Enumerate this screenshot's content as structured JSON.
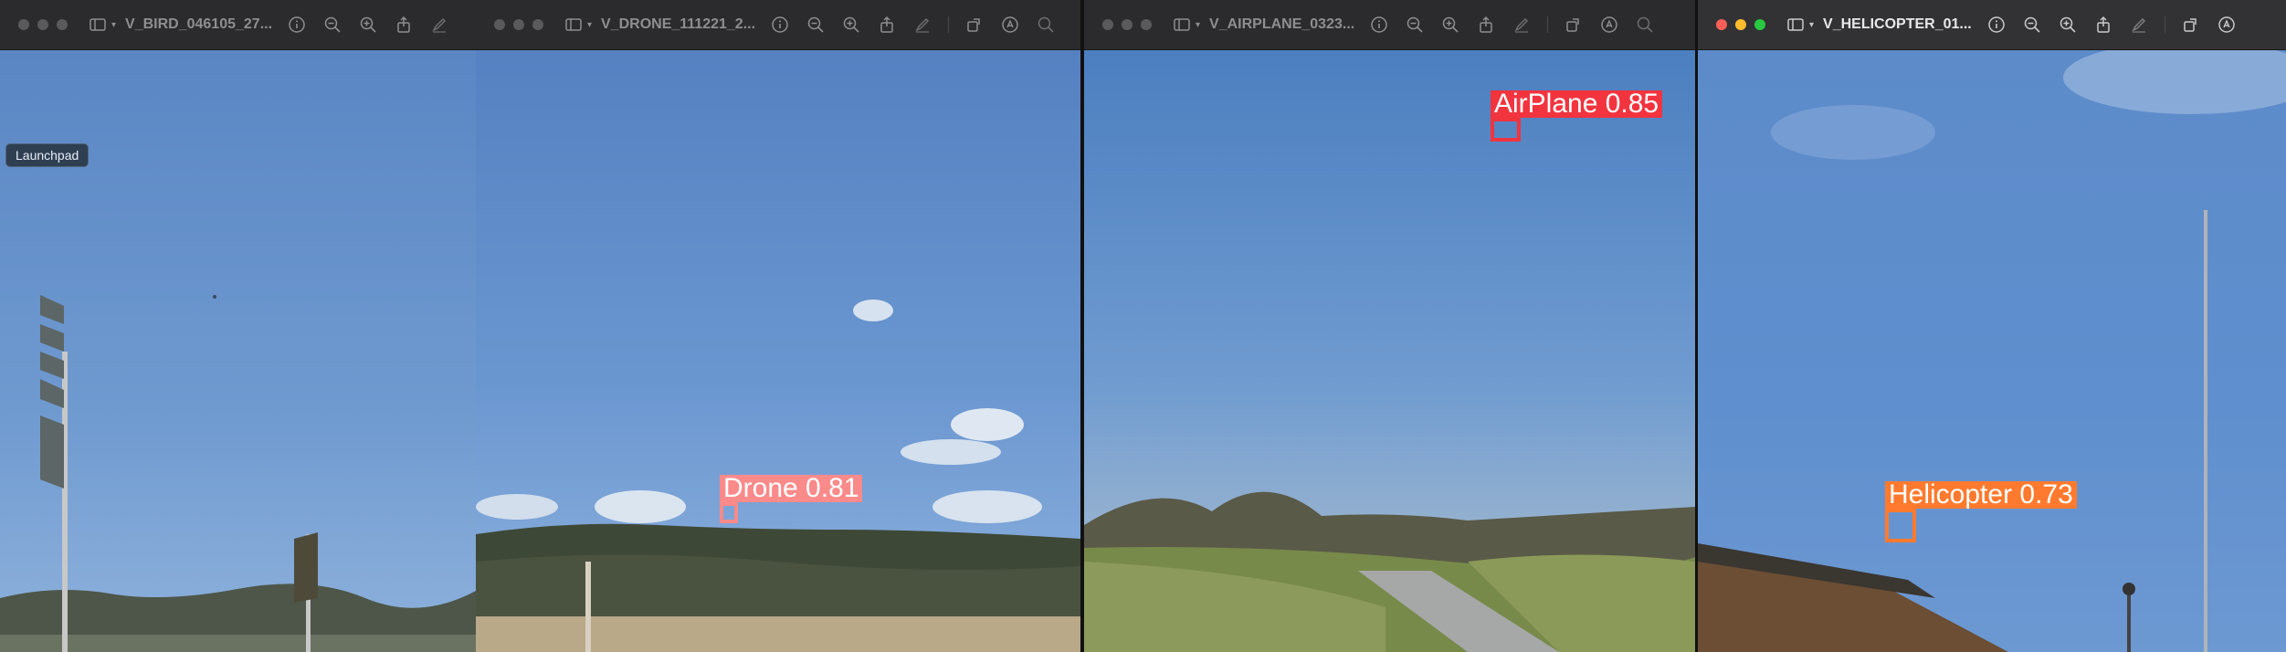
{
  "windows": [
    {
      "title": "V_BIRD_046105_27...",
      "active": false
    },
    {
      "title": "V_DRONE_111221_2...",
      "active": false
    },
    {
      "title": "V_AIRPLANE_0323...",
      "active": false
    },
    {
      "title": "V_HELICOPTER_01...",
      "active": true
    }
  ],
  "tooltip": {
    "text": "Launchpad"
  },
  "detections": [
    {
      "label": "Drone 0.81",
      "class": "Drone",
      "confidence": 0.81,
      "color": "#fb8a8a"
    },
    {
      "label": "AirPlane 0.85",
      "class": "AirPlane",
      "confidence": 0.85,
      "color": "#f2343f"
    },
    {
      "label": "Helicopter 0.73",
      "class": "Helicopter",
      "confidence": 0.73,
      "color": "#ff7a2e"
    }
  ],
  "icons": [
    "sidebar-icon",
    "chevron-down-icon",
    "info-icon",
    "zoom-out-icon",
    "zoom-in-icon",
    "share-icon",
    "markup-icon",
    "rotate-icon",
    "annotate-icon",
    "search-icon"
  ]
}
